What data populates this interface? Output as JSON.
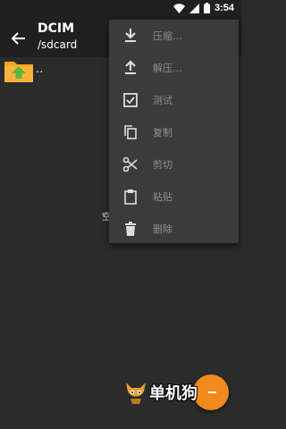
{
  "status_bar": {
    "time": "3:54",
    "icons": [
      "wifi-icon",
      "signal-icon",
      "battery-icon"
    ]
  },
  "app_bar": {
    "title": "DCIM",
    "subtitle": "/sdcard"
  },
  "list": {
    "items": [
      {
        "label": ".."
      }
    ]
  },
  "empty_text": "空",
  "menu": {
    "items": [
      {
        "label": "压缩...",
        "icon": "download-icon"
      },
      {
        "label": "解压...",
        "icon": "upload-icon"
      },
      {
        "label": "测试",
        "icon": "checkbox-icon"
      },
      {
        "label": "复制",
        "icon": "copy-icon"
      },
      {
        "label": "剪切",
        "icon": "scissors-icon"
      },
      {
        "label": "粘贴",
        "icon": "clipboard-icon"
      },
      {
        "label": "删除",
        "icon": "trash-icon"
      }
    ]
  },
  "watermark": {
    "text": "单机狗"
  },
  "colors": {
    "accent": "#f08a1c",
    "menu_bg": "#3b3b3b",
    "background": "#2b2b2b",
    "folder": "#f5a623"
  }
}
